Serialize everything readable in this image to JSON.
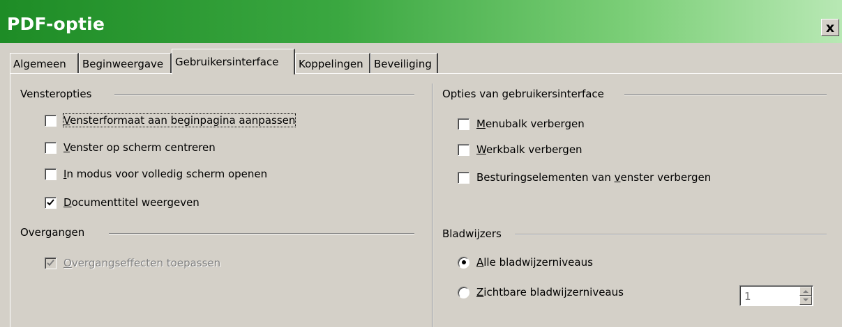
{
  "window": {
    "title": "PDF-optie",
    "close_label": "x"
  },
  "tabs": [
    {
      "label": "Algemeen",
      "active": false
    },
    {
      "label": "Beginweergave",
      "active": false
    },
    {
      "label": "Gebruikersinterface",
      "active": true
    },
    {
      "label": "Koppelingen",
      "active": false
    },
    {
      "label": "Beveiliging",
      "active": false
    }
  ],
  "left": {
    "window_options": {
      "title": "Vensteropties",
      "items": [
        {
          "accel": "V",
          "rest": "ensterformaat aan beginpagina aanpassen",
          "checked": false,
          "focused": true
        },
        {
          "accel": "V",
          "rest": "enster op scherm centreren",
          "checked": false
        },
        {
          "accel": "I",
          "rest": "n modus voor volledig scherm openen",
          "checked": false
        },
        {
          "accel": "D",
          "rest": "ocumenttitel weergeven",
          "checked": true
        }
      ]
    },
    "transitions": {
      "title": "Overgangen",
      "items": [
        {
          "accel": "O",
          "rest": "vergangseffecten toepassen",
          "checked": true,
          "disabled": true
        }
      ]
    }
  },
  "right": {
    "ui_options": {
      "title": "Opties van gebruikersinterface",
      "items": [
        {
          "accel": "M",
          "rest": "enubalk verbergen",
          "checked": false
        },
        {
          "accel": "W",
          "rest": "erkbalk verbergen",
          "checked": false
        },
        {
          "before": "Besturingselementen van ",
          "accel": "v",
          "rest": "enster verbergen",
          "checked": false
        }
      ]
    },
    "bookmarks": {
      "title": "Bladwijzers",
      "items": [
        {
          "accel": "A",
          "rest": "lle bladwijzerniveaus",
          "selected": true
        },
        {
          "accel": "Z",
          "rest": "ichtbare bladwijzerniveaus",
          "selected": false
        }
      ],
      "levels_value": "1"
    }
  },
  "colors": {
    "titlebar_start": "#1e8c26",
    "titlebar_end": "#b8e8b4",
    "dialog_bg": "#d4d0c8"
  }
}
